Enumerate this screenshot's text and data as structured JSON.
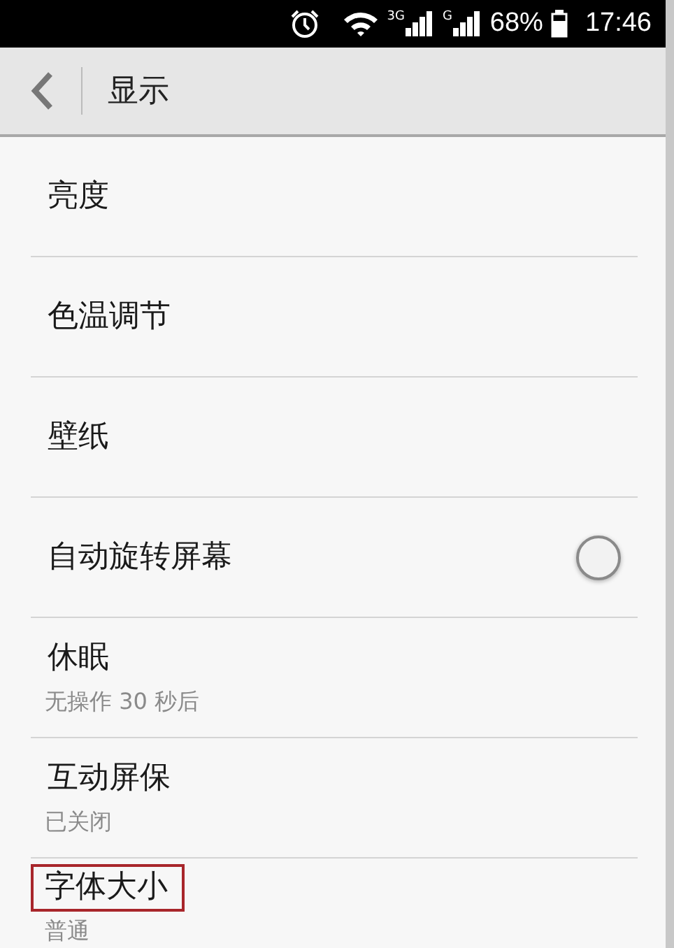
{
  "status_bar": {
    "network_1": "3G",
    "network_2": "G",
    "battery": "68%",
    "time": "17:46"
  },
  "header": {
    "title": "显示"
  },
  "items": [
    {
      "kind": "plain",
      "title": "亮度",
      "highlighted": false
    },
    {
      "kind": "plain",
      "title": "色温调节",
      "highlighted": false
    },
    {
      "kind": "plain",
      "title": "壁纸",
      "highlighted": false
    },
    {
      "kind": "toggle",
      "title": "自动旋转屏幕",
      "on": false,
      "highlighted": false
    },
    {
      "kind": "subtitle",
      "title": "休眠",
      "subtitle": "无操作 30 秒后",
      "highlighted": false
    },
    {
      "kind": "subtitle",
      "title": "互动屏保",
      "subtitle": "已关闭",
      "highlighted": false
    },
    {
      "kind": "subtitle",
      "title": "字体大小",
      "subtitle": "普通",
      "highlighted": true
    }
  ]
}
